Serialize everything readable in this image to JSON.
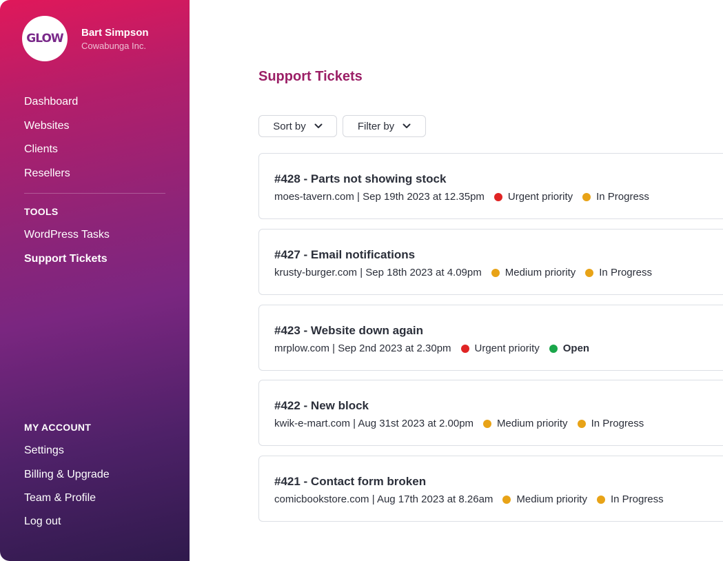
{
  "colors": {
    "accent": "#9b1f66",
    "urgent": "#e02424",
    "medium": "#e8a317",
    "in_progress": "#e8a317",
    "open": "#1aa64a"
  },
  "user": {
    "logo_text": "GLOW",
    "name": "Bart Simpson",
    "org": "Cowabunga Inc."
  },
  "nav": {
    "main": [
      "Dashboard",
      "Websites",
      "Clients",
      "Resellers"
    ],
    "tools_title": "TOOLS",
    "tools": [
      "WordPress Tasks",
      "Support Tickets"
    ],
    "account_title": "MY ACCOUNT",
    "account": [
      "Settings",
      "Billing & Upgrade",
      "Team & Profile",
      "Log out"
    ]
  },
  "page": {
    "title": "Support Tickets",
    "sort_label": "Sort by",
    "filter_label": "Filter by"
  },
  "tickets": [
    {
      "title": "#428 - Parts not showing stock",
      "meta": "moes-tavern.com | Sep 19th 2023 at 12.35pm",
      "priority": "Urgent priority",
      "priority_color": "#e02424",
      "status": "In Progress",
      "status_color": "#e8a317"
    },
    {
      "title": "#427 - Email notifications",
      "meta": "krusty-burger.com | Sep 18th 2023 at 4.09pm",
      "priority": "Medium priority",
      "priority_color": "#e8a317",
      "status": "In Progress",
      "status_color": "#e8a317"
    },
    {
      "title": "#423 - Website down again",
      "meta": "mrplow.com | Sep 2nd 2023 at 2.30pm",
      "priority": "Urgent priority",
      "priority_color": "#e02424",
      "status": "Open",
      "status_color": "#1aa64a"
    },
    {
      "title": "#422 - New block",
      "meta": "kwik-e-mart.com | Aug 31st 2023 at 2.00pm",
      "priority": "Medium priority",
      "priority_color": "#e8a317",
      "status": "In Progress",
      "status_color": "#e8a317"
    },
    {
      "title": "#421 -  Contact form broken",
      "meta": "comicbookstore.com | Aug 17th 2023 at 8.26am",
      "priority": "Medium priority",
      "priority_color": "#e8a317",
      "status": "In Progress",
      "status_color": "#e8a317"
    }
  ]
}
